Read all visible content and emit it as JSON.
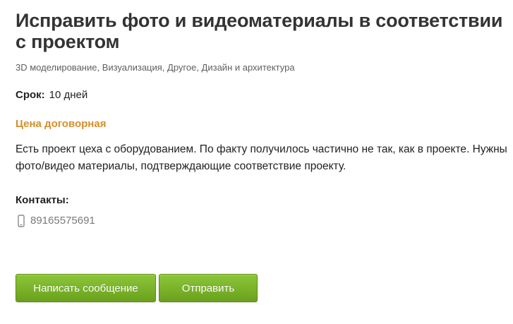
{
  "project": {
    "title": "Исправить фото и видеоматериалы в соответствии с проектом",
    "categories": "3D моделирование, Визуализация, Другое, Дизайн и архитектура",
    "deadline_label": "Срок:",
    "deadline_value": "10 дней",
    "price": "Цена договорная",
    "description": "Есть проект цеха с оборудованием. По факту получилось частично не так, как в проекте. Нужны фото/видео материалы, подтверждающие соответствие проекту."
  },
  "contacts": {
    "title": "Контакты:",
    "phone": "89165575691",
    "phone_icon": "mobile-phone-icon"
  },
  "actions": {
    "message_label": "Написать сообщение",
    "send_label": "Отправить"
  },
  "colors": {
    "price": "#d58f2b",
    "button": "#78b027"
  }
}
